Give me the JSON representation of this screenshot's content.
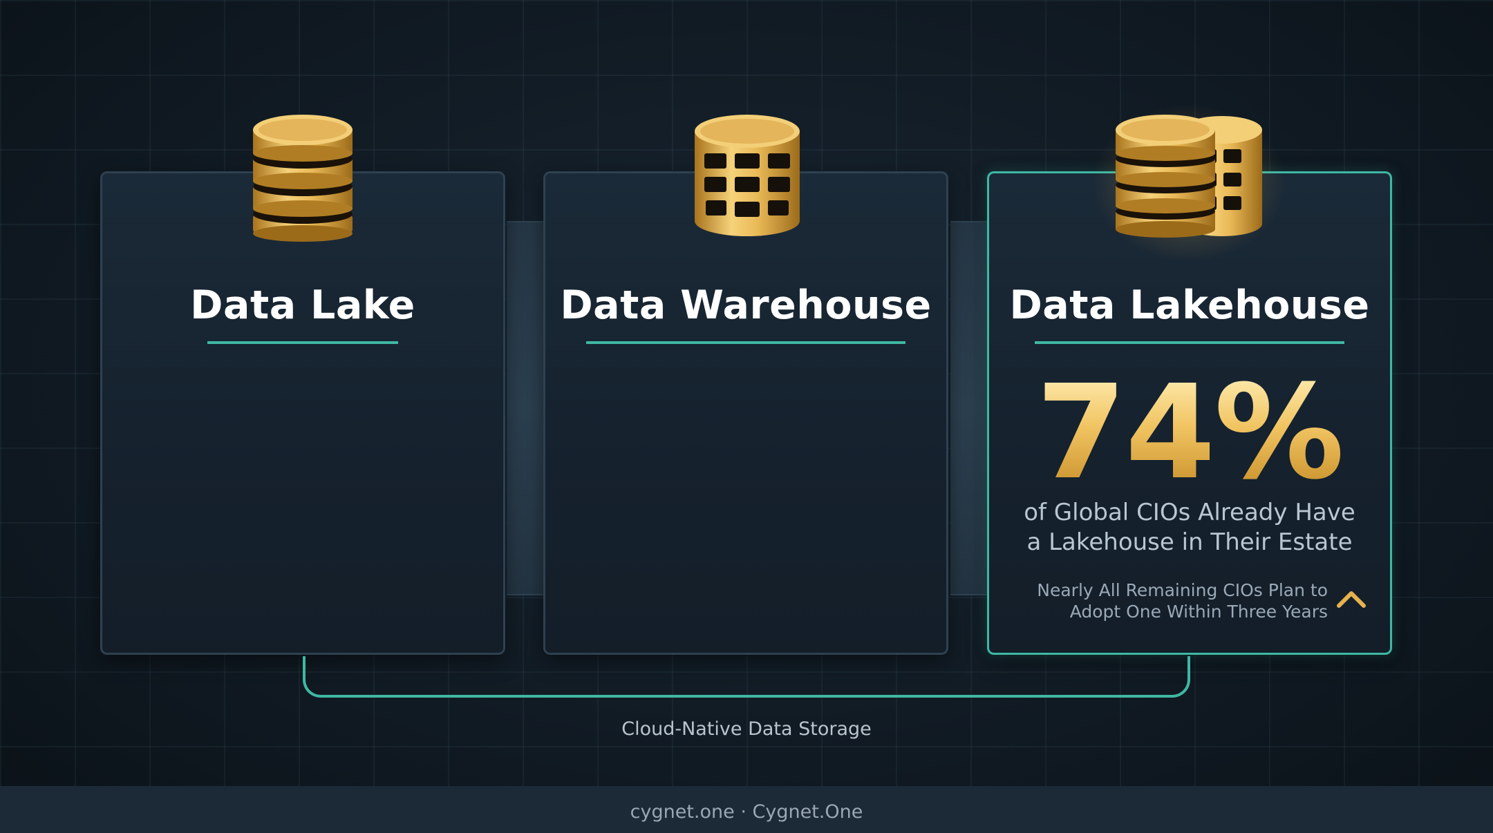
{
  "cards": [
    {
      "title": "Data Lake",
      "icon": "database-stack-icon"
    },
    {
      "title": "Data Warehouse",
      "icon": "database-table-icon"
    },
    {
      "title": "Data Lakehouse",
      "icon": "database-hybrid-icon",
      "stat_value": "74%",
      "stat_description_line1": "of Global CIOs Already Have",
      "stat_description_line2": "a Lakehouse in Their Estate",
      "note_line1": "Nearly All Remaining CIOs Plan to",
      "note_line2": "Adopt One Within Three Years",
      "note_icon": "chevron-up-icon"
    }
  ],
  "caption": "Cloud-Native Data Storage",
  "footer": "cygnet.one · Cygnet.One",
  "colors": {
    "accent": "#3fb8a3",
    "gold": "#e7b24d",
    "background": "#111b24",
    "card": "#17232f"
  }
}
